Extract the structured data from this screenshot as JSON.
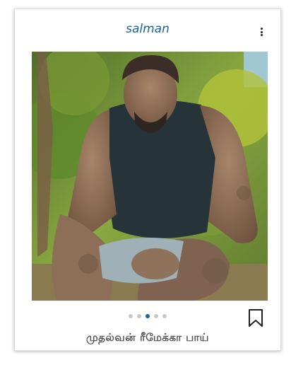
{
  "post": {
    "username": "salman",
    "caption": "முதல்வன் ரீமேக்கா பாய்",
    "slides": {
      "count": 5,
      "active_index": 2
    },
    "image_icon": "photo-of-man-with-mud",
    "more_icon": "more-vertical-icon",
    "bookmark_icon": "bookmark-icon"
  },
  "colors": {
    "username": "#1a63a0",
    "active_dot": "#1a63a0",
    "inactive_dot": "#c8c8c8",
    "caption": "#555555"
  }
}
